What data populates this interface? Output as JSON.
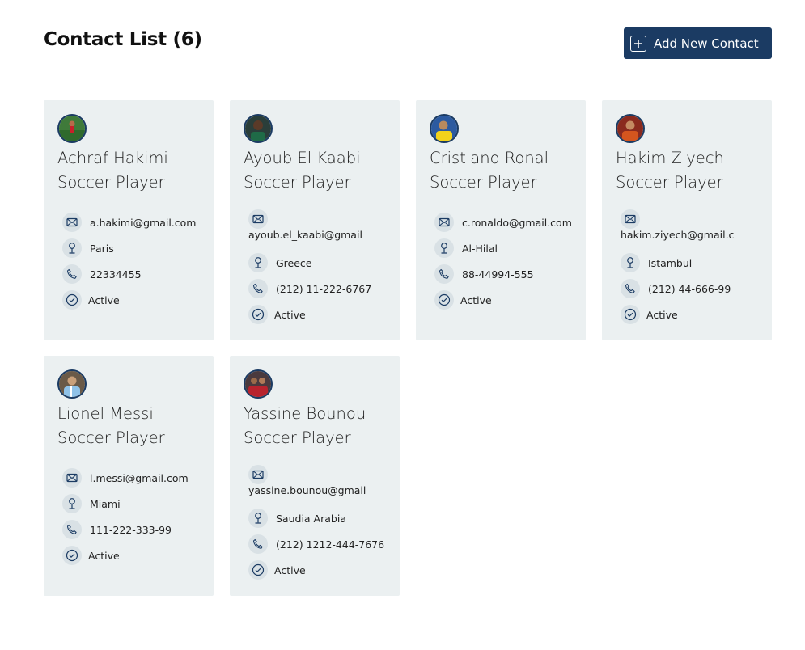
{
  "header": {
    "title": "Contact List (6)",
    "add_button_label": "Add New Contact"
  },
  "contacts": [
    {
      "name": "Achraf Hakimi",
      "role": "Soccer Player",
      "email": "a.hakimi@gmail.com",
      "location": "Paris",
      "phone": "22334455",
      "status": "Active",
      "email_wrapped": false
    },
    {
      "name": "Ayoub El Kaabi",
      "role": "Soccer Player",
      "email": "ayoub.el_kaabi@gmail",
      "location": "Greece",
      "phone": "(212) 11-222-6767",
      "status": "Active",
      "email_wrapped": true
    },
    {
      "name": "Cristiano Ronal",
      "role": "Soccer Player",
      "email": "c.ronaldo@gmail.com",
      "location": "Al-Hilal",
      "phone": "88-44994-555",
      "status": "Active",
      "email_wrapped": false
    },
    {
      "name": "Hakim Ziyech",
      "role": "Soccer Player",
      "email": "hakim.ziyech@gmail.c",
      "location": "Istambul",
      "phone": "(212) 44-666-99",
      "status": "Active",
      "email_wrapped": true
    },
    {
      "name": "Lionel Messi",
      "role": "Soccer Player",
      "email": "l.messi@gmail.com",
      "location": "Miami",
      "phone": "111-222-333-99",
      "status": "Active",
      "email_wrapped": false
    },
    {
      "name": "Yassine Bounou",
      "role": "Soccer Player",
      "email": "yassine.bounou@gmail",
      "location": "Saudia Arabia",
      "phone": "(212) 1212-444-7676",
      "status": "Active",
      "email_wrapped": true
    }
  ],
  "icons": {
    "email": "mail-icon",
    "location": "map-pin-icon",
    "phone": "phone-icon",
    "status": "check-circle-icon",
    "add": "plus-square-icon"
  },
  "colors": {
    "accent": "#1b3b63",
    "card_bg": "#ebf0f1",
    "icon_bg": "#d9e1e5"
  }
}
